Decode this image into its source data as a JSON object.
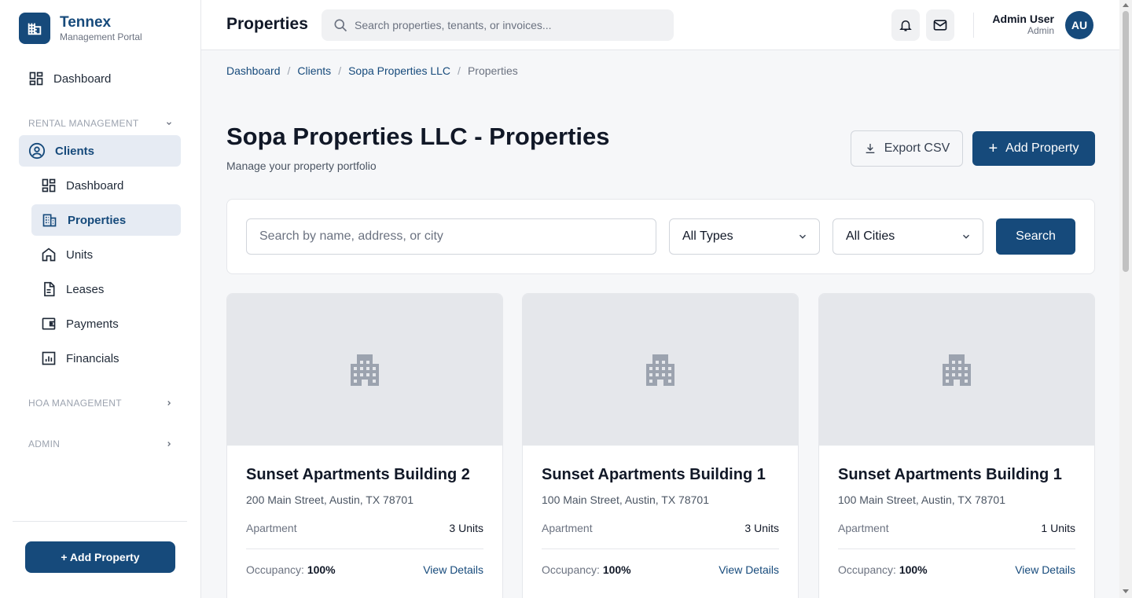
{
  "brand": {
    "name": "Tennex",
    "subtitle": "Management Portal"
  },
  "sidebar": {
    "dashboard_label": "Dashboard",
    "sections": {
      "rental": "RENTAL MANAGEMENT",
      "hoa": "HOA MANAGEMENT",
      "admin": "ADMIN"
    },
    "clients_label": "Clients",
    "sub_items": [
      {
        "label": "Dashboard",
        "icon": "dashboard-icon"
      },
      {
        "label": "Properties",
        "icon": "building-icon",
        "active": true
      },
      {
        "label": "Units",
        "icon": "home-icon"
      },
      {
        "label": "Leases",
        "icon": "document-icon"
      },
      {
        "label": "Payments",
        "icon": "wallet-icon"
      },
      {
        "label": "Financials",
        "icon": "chart-icon"
      }
    ],
    "add_button": "+ Add Property"
  },
  "header": {
    "title": "Properties",
    "search_placeholder": "Search properties, tenants, or invoices...",
    "user_name": "Admin User",
    "user_role": "Admin",
    "avatar_initials": "AU"
  },
  "breadcrumb": [
    "Dashboard",
    "Clients",
    "Sopa Properties LLC",
    "Properties"
  ],
  "page": {
    "title": "Sopa Properties LLC - Properties",
    "subtitle": "Manage your property portfolio",
    "export_label": "Export CSV",
    "add_label": "Add Property"
  },
  "filters": {
    "search_placeholder": "Search by name, address, or city",
    "type_value": "All Types",
    "city_value": "All Cities",
    "search_button": "Search"
  },
  "properties": [
    {
      "name": "Sunset Apartments Building 2",
      "address": "200 Main Street, Austin, TX 78701",
      "type": "Apartment",
      "units": "3 Units",
      "occupancy_label": "Occupancy:",
      "occupancy": "100%",
      "link": "View Details"
    },
    {
      "name": "Sunset Apartments Building 1",
      "address": "100 Main Street, Austin, TX 78701",
      "type": "Apartment",
      "units": "3 Units",
      "occupancy_label": "Occupancy:",
      "occupancy": "100%",
      "link": "View Details"
    },
    {
      "name": "Sunset Apartments Building 1",
      "address": "100 Main Street, Austin, TX 78701",
      "type": "Apartment",
      "units": "1 Units",
      "occupancy_label": "Occupancy:",
      "occupancy": "100%",
      "link": "View Details"
    }
  ],
  "colors": {
    "primary": "#164a7b",
    "active_bg": "#e6ebf3",
    "page_bg": "#f6f7f9"
  }
}
